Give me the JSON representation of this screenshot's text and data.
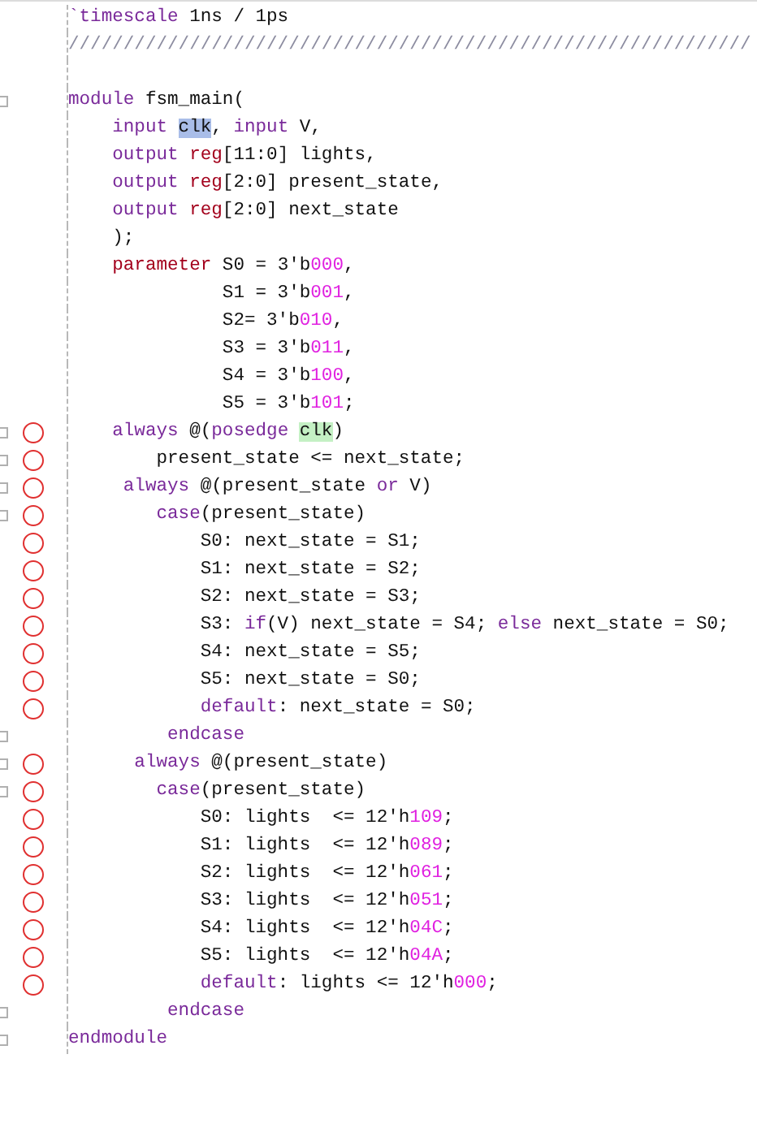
{
  "lines": [
    {
      "fold": false,
      "breakpoint": false,
      "tokens": [
        {
          "text": "`timescale",
          "kind": "directive"
        },
        {
          "text": " 1ns / 1ps",
          "kind": "plain"
        }
      ]
    },
    {
      "fold": false,
      "breakpoint": false,
      "tokens": [
        {
          "text": "//////////////////////////////////////////////////////////////",
          "kind": "comment"
        }
      ]
    },
    {
      "fold": false,
      "breakpoint": false
    },
    {
      "fold": true,
      "breakpoint": false,
      "tokens": [
        {
          "text": "module",
          "kind": "keyword"
        },
        {
          "text": " fsm_main(",
          "kind": "plain"
        }
      ]
    },
    {
      "fold": false,
      "breakpoint": false,
      "tokens": [
        {
          "text": "    input ",
          "kind": "keyword"
        },
        {
          "text": "clk",
          "kind": "selection"
        },
        {
          "text": ", ",
          "kind": "plain"
        },
        {
          "text": "input",
          "kind": "keyword"
        },
        {
          "text": " V,",
          "kind": "plain"
        }
      ]
    },
    {
      "fold": false,
      "breakpoint": false,
      "tokens": [
        {
          "text": "    output ",
          "kind": "keyword"
        },
        {
          "text": "reg",
          "kind": "type"
        },
        {
          "text": "[11:0] lights,",
          "kind": "plain"
        }
      ]
    },
    {
      "fold": false,
      "breakpoint": false,
      "tokens": [
        {
          "text": "    output ",
          "kind": "keyword"
        },
        {
          "text": "reg",
          "kind": "type"
        },
        {
          "text": "[2:0] present_state,",
          "kind": "plain"
        }
      ]
    },
    {
      "fold": false,
      "breakpoint": false,
      "tokens": [
        {
          "text": "    output ",
          "kind": "keyword"
        },
        {
          "text": "reg",
          "kind": "type"
        },
        {
          "text": "[2:0] next_state",
          "kind": "plain"
        }
      ]
    },
    {
      "fold": false,
      "breakpoint": false,
      "tokens": [
        {
          "text": "    );",
          "kind": "plain"
        }
      ]
    },
    {
      "fold": false,
      "breakpoint": false,
      "tokens": [
        {
          "text": "    parameter",
          "kind": "type"
        },
        {
          "text": " S0 = 3'b",
          "kind": "plain"
        },
        {
          "text": "000",
          "kind": "number"
        },
        {
          "text": ",",
          "kind": "plain"
        }
      ]
    },
    {
      "fold": false,
      "breakpoint": false,
      "tokens": [
        {
          "text": "              S1 = 3'b",
          "kind": "plain"
        },
        {
          "text": "001",
          "kind": "number"
        },
        {
          "text": ",",
          "kind": "plain"
        }
      ]
    },
    {
      "fold": false,
      "breakpoint": false,
      "tokens": [
        {
          "text": "              S2= 3'b",
          "kind": "plain"
        },
        {
          "text": "010",
          "kind": "number"
        },
        {
          "text": ",",
          "kind": "plain"
        }
      ]
    },
    {
      "fold": false,
      "breakpoint": false,
      "tokens": [
        {
          "text": "              S3 = 3'b",
          "kind": "plain"
        },
        {
          "text": "011",
          "kind": "number"
        },
        {
          "text": ",",
          "kind": "plain"
        }
      ]
    },
    {
      "fold": false,
      "breakpoint": false,
      "tokens": [
        {
          "text": "              S4 = 3'b",
          "kind": "plain"
        },
        {
          "text": "100",
          "kind": "number"
        },
        {
          "text": ",",
          "kind": "plain"
        }
      ]
    },
    {
      "fold": false,
      "breakpoint": false,
      "tokens": [
        {
          "text": "              S5 = 3'b",
          "kind": "plain"
        },
        {
          "text": "101",
          "kind": "number"
        },
        {
          "text": ";",
          "kind": "plain"
        }
      ]
    },
    {
      "fold": true,
      "breakpoint": true,
      "tokens": [
        {
          "text": "    always",
          "kind": "keyword"
        },
        {
          "text": " @(",
          "kind": "plain"
        },
        {
          "text": "posedge ",
          "kind": "keyword"
        },
        {
          "text": "clk",
          "kind": "match"
        },
        {
          "text": ")",
          "kind": "plain"
        }
      ]
    },
    {
      "fold": true,
      "breakpoint": true,
      "tokens": [
        {
          "text": "        present_state <= next_state;",
          "kind": "plain"
        }
      ]
    },
    {
      "fold": true,
      "breakpoint": true,
      "tokens": [
        {
          "text": "     always",
          "kind": "keyword"
        },
        {
          "text": " @(present_state ",
          "kind": "plain"
        },
        {
          "text": "or",
          "kind": "keyword"
        },
        {
          "text": " V)",
          "kind": "plain"
        }
      ]
    },
    {
      "fold": true,
      "breakpoint": true,
      "tokens": [
        {
          "text": "        case",
          "kind": "keyword"
        },
        {
          "text": "(present_state)",
          "kind": "plain"
        }
      ]
    },
    {
      "fold": false,
      "breakpoint": true,
      "tokens": [
        {
          "text": "            S0: next_state = S1;",
          "kind": "plain"
        }
      ]
    },
    {
      "fold": false,
      "breakpoint": true,
      "tokens": [
        {
          "text": "            S1: next_state = S2;",
          "kind": "plain"
        }
      ]
    },
    {
      "fold": false,
      "breakpoint": true,
      "tokens": [
        {
          "text": "            S2: next_state = S3;",
          "kind": "plain"
        }
      ]
    },
    {
      "fold": false,
      "breakpoint": true,
      "tokens": [
        {
          "text": "            S3: ",
          "kind": "plain"
        },
        {
          "text": "if",
          "kind": "keyword"
        },
        {
          "text": "(V) next_state = S4; ",
          "kind": "plain"
        },
        {
          "text": "else",
          "kind": "keyword"
        },
        {
          "text": " next_state = S0;",
          "kind": "plain"
        }
      ]
    },
    {
      "fold": false,
      "breakpoint": true,
      "tokens": [
        {
          "text": "            S4: next_state = S5;",
          "kind": "plain"
        }
      ]
    },
    {
      "fold": false,
      "breakpoint": true,
      "tokens": [
        {
          "text": "            S5: next_state = S0;",
          "kind": "plain"
        }
      ]
    },
    {
      "fold": false,
      "breakpoint": true,
      "tokens": [
        {
          "text": "            default",
          "kind": "keyword"
        },
        {
          "text": ": next_state = S0;",
          "kind": "plain"
        }
      ]
    },
    {
      "fold": true,
      "breakpoint": false,
      "tokens": [
        {
          "text": "         endcase",
          "kind": "keyword"
        }
      ]
    },
    {
      "fold": true,
      "breakpoint": true,
      "tokens": [
        {
          "text": "      always",
          "kind": "keyword"
        },
        {
          "text": " @(present_state)",
          "kind": "plain"
        }
      ]
    },
    {
      "fold": true,
      "breakpoint": true,
      "tokens": [
        {
          "text": "        case",
          "kind": "keyword"
        },
        {
          "text": "(present_state)",
          "kind": "plain"
        }
      ]
    },
    {
      "fold": false,
      "breakpoint": true,
      "tokens": [
        {
          "text": "            S0: lights  <= 12'h",
          "kind": "plain"
        },
        {
          "text": "109",
          "kind": "number"
        },
        {
          "text": ";",
          "kind": "plain"
        }
      ]
    },
    {
      "fold": false,
      "breakpoint": true,
      "tokens": [
        {
          "text": "            S1: lights  <= 12'h",
          "kind": "plain"
        },
        {
          "text": "089",
          "kind": "number"
        },
        {
          "text": ";",
          "kind": "plain"
        }
      ]
    },
    {
      "fold": false,
      "breakpoint": true,
      "tokens": [
        {
          "text": "            S2: lights  <= 12'h",
          "kind": "plain"
        },
        {
          "text": "061",
          "kind": "number"
        },
        {
          "text": ";",
          "kind": "plain"
        }
      ]
    },
    {
      "fold": false,
      "breakpoint": true,
      "tokens": [
        {
          "text": "            S3: lights  <= 12'h",
          "kind": "plain"
        },
        {
          "text": "051",
          "kind": "number"
        },
        {
          "text": ";",
          "kind": "plain"
        }
      ]
    },
    {
      "fold": false,
      "breakpoint": true,
      "tokens": [
        {
          "text": "            S4: lights  <= 12'h",
          "kind": "plain"
        },
        {
          "text": "04C",
          "kind": "number"
        },
        {
          "text": ";",
          "kind": "plain"
        }
      ]
    },
    {
      "fold": false,
      "breakpoint": true,
      "tokens": [
        {
          "text": "            S5: lights  <= 12'h",
          "kind": "plain"
        },
        {
          "text": "04A",
          "kind": "number"
        },
        {
          "text": ";",
          "kind": "plain"
        }
      ]
    },
    {
      "fold": false,
      "breakpoint": true,
      "tokens": [
        {
          "text": "            default",
          "kind": "keyword"
        },
        {
          "text": ": lights <= 12'h",
          "kind": "plain"
        },
        {
          "text": "000",
          "kind": "number"
        },
        {
          "text": ";",
          "kind": "plain"
        }
      ]
    },
    {
      "fold": true,
      "breakpoint": false,
      "tokens": [
        {
          "text": "         endcase",
          "kind": "keyword"
        }
      ]
    },
    {
      "fold": true,
      "breakpoint": false,
      "tokens": [
        {
          "text": "endmodule",
          "kind": "keyword"
        }
      ]
    }
  ]
}
